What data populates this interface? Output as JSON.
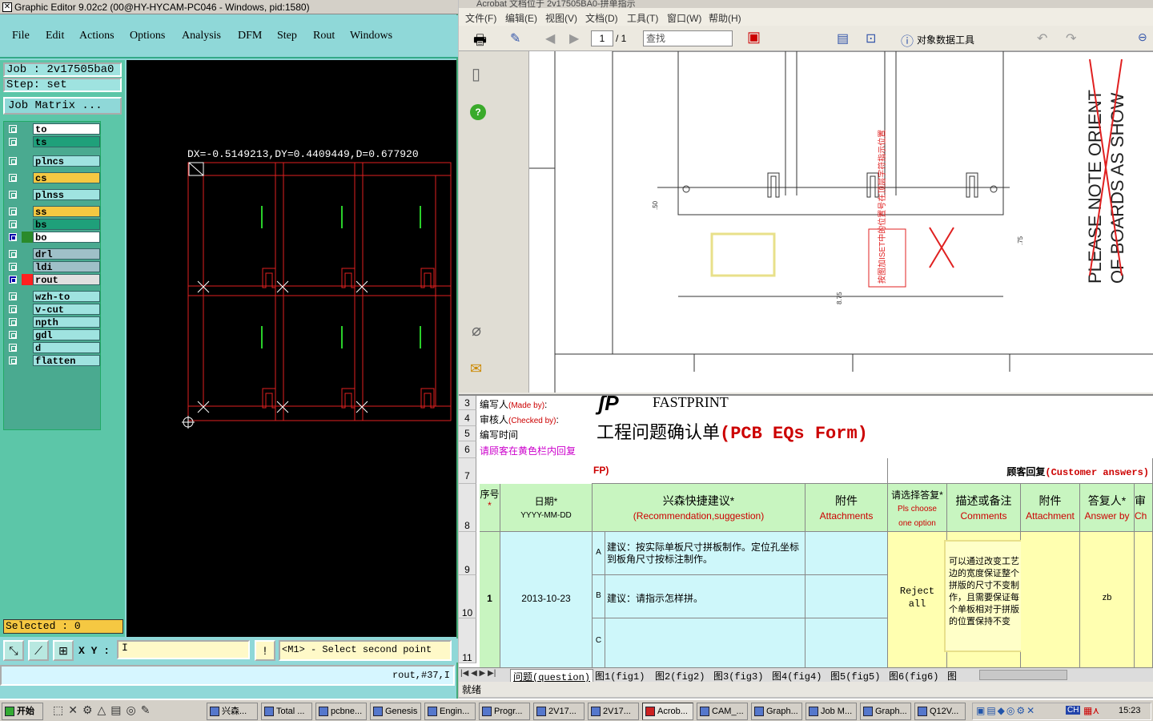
{
  "editor": {
    "title": "Graphic Editor 9.02c2 (00@HY-HYCAM-PC046 - Windows, pid:1580)",
    "menu": [
      "File",
      "Edit",
      "Actions",
      "Options",
      "Analysis",
      "DFM",
      "Step",
      "Rout",
      "Windows"
    ],
    "job": "Job : 2v17505ba0",
    "step": "Step: set",
    "job_matrix": "Job Matrix ...",
    "layers": [
      {
        "name": "to",
        "color": "#ffffff",
        "swatch": ""
      },
      {
        "name": "ts",
        "color": "#1fa07a",
        "swatch": ""
      },
      {
        "name": "plncs",
        "color": "#9fe3e0",
        "swatch": ""
      },
      {
        "name": "cs",
        "color": "#f5c842",
        "swatch": ""
      },
      {
        "name": "plnss",
        "color": "#9fe3e0",
        "swatch": ""
      },
      {
        "name": "ss",
        "color": "#f5c842",
        "swatch": ""
      },
      {
        "name": "bs",
        "color": "#1fa07a",
        "swatch": ""
      },
      {
        "name": "bo",
        "color": "#ffffff",
        "swatch": "#2a8a2a"
      },
      {
        "name": "drl",
        "color": "#9fc0c8",
        "swatch": ""
      },
      {
        "name": "ldi",
        "color": "#9fc0c8",
        "swatch": ""
      },
      {
        "name": "rout",
        "color": "#e0e0e0",
        "swatch": "#ff2020"
      },
      {
        "name": "wzh-to",
        "color": "#9fe3e0",
        "swatch": ""
      },
      {
        "name": "v-cut",
        "color": "#9fe3e0",
        "swatch": ""
      },
      {
        "name": "npth",
        "color": "#9fe3e0",
        "swatch": ""
      },
      {
        "name": "gdl",
        "color": "#9fe3e0",
        "swatch": ""
      },
      {
        "name": "d",
        "color": "#9fe3e0",
        "swatch": ""
      },
      {
        "name": "flatten",
        "color": "#9fe3e0",
        "swatch": ""
      }
    ],
    "selected": "Selected : 0",
    "measure": "DX=-0.5149213,DY=0.4409449,D=0.677920",
    "xy_label": "X Y :",
    "xy_value": "I",
    "prompt_icon": "!",
    "prompt": "<M1> - Select second point",
    "status": "rout,#37,I"
  },
  "acrobat": {
    "title": "Acrobat 文档位于 2v17505BA0-拼单指示",
    "menu": [
      "文件(F)",
      "编辑(E)",
      "视图(V)",
      "文档(D)",
      "工具(T)",
      "窗口(W)",
      "帮助(H)"
    ],
    "page_current": "1",
    "page_total": "/ 1",
    "search_placeholder": "查找",
    "tool_label": "对象数据工具",
    "drawing_texts": {
      "note1": "PLEASE NOTE ORIENT",
      "note2": "OF BOARDS AS SHOW",
      "red_box": "按图加ISET中的位置号在顶层字符指示位置",
      "dim1": "8.75",
      "dim2": ".50",
      "dim3": ".75"
    }
  },
  "excel": {
    "rows": [
      {
        "n": "3",
        "label": "编写人",
        "label_en": "(Made by)",
        "suffix": ":"
      },
      {
        "n": "4",
        "label": "审核人",
        "label_en": "(Checked by)",
        "suffix": ":"
      },
      {
        "n": "5",
        "label": "编写时间",
        "label_en": "",
        "suffix": ""
      },
      {
        "n": "6",
        "label": "请顾客在黄色栏内回复",
        "label_en": "",
        "suffix": ""
      }
    ],
    "brand": "FASTPRINT",
    "form_title_cn": "工程问题确认单",
    "form_title_en": "(PCB EQs Form)",
    "fp_fragment": "FP)",
    "customer_header_cn": "顾客回复",
    "customer_header_en": "(Customer answers)",
    "row_numbers": [
      "7",
      "8",
      "9",
      "10",
      "11"
    ],
    "col_headers": {
      "seq": "序号",
      "date_cn": "日期*",
      "date_fmt": "YYYY-MM-DD",
      "rec_cn": "兴森快捷建议*",
      "rec_en": "(Recommendation,suggestion)",
      "att_cn": "附件",
      "att_en": "Attachments",
      "choose_cn": "请选择答复*",
      "choose_en1": "Pls choose",
      "choose_en2": "one option",
      "desc_cn": "描述或备注",
      "desc_en": "Comments",
      "att2_cn": "附件",
      "att2_en": "Attachment",
      "ans_cn": "答复人*",
      "ans_en": "Answer by",
      "chk_cn": "审",
      "chk_en": "Ch"
    },
    "item": {
      "seq": "1",
      "date": "2013-10-23",
      "sub_a": "A",
      "sub_b": "B",
      "sub_c": "C",
      "rec_a": "建议：按实际单板尺寸拼板制作。定位孔坐标到板角尺寸按标注制作。",
      "rec_b": "建议：请指示怎样拼。",
      "choice": "Reject all",
      "comment": "可以通过改变工艺边的宽度保证整个拼版的尺寸不变制作，且需要保证每个单板相对于拼版的位置保持不变",
      "answer_by": "zb"
    },
    "tabs": [
      "问题(question)",
      "图1(fig1)",
      "图2(fig2)",
      "图3(fig3)",
      "图4(fig4)",
      "图5(fig5)",
      "图6(fig6)",
      "图"
    ],
    "status": "就绪"
  },
  "taskbar": {
    "start": "开始",
    "items": [
      "兴森...",
      "Total ...",
      "pcbne...",
      "Genesis",
      "Engin...",
      "Progr...",
      "2V17...",
      "2V17...",
      "Acrob...",
      "CAM_...",
      "Graph...",
      "Job M...",
      "Graph...",
      "Q12V..."
    ],
    "tray_ch": "CH",
    "clock": "15:23"
  }
}
